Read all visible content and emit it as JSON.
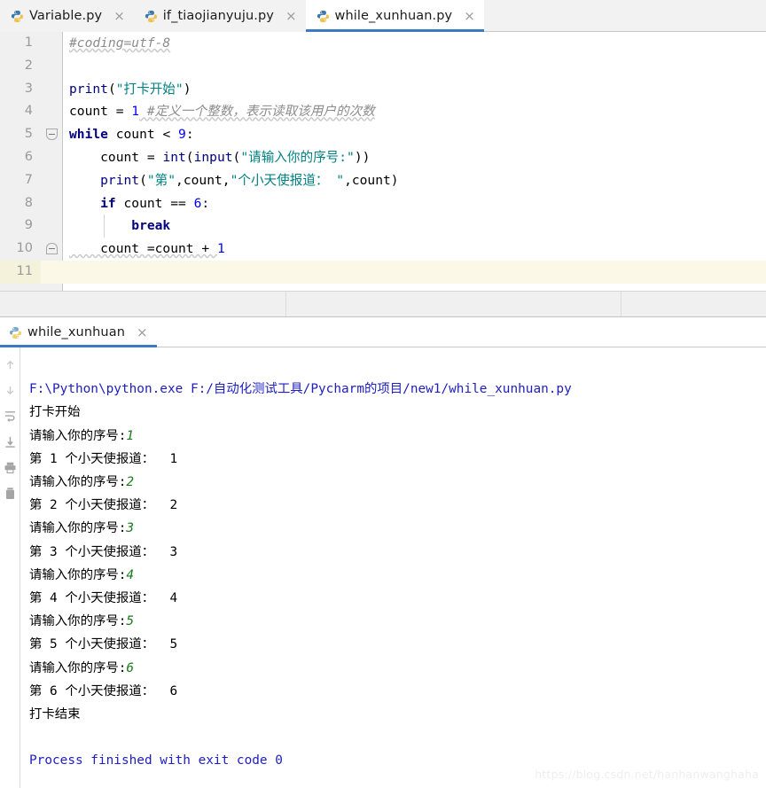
{
  "colors": {
    "accent": "#3a7cc4",
    "tab_inactive_bg": "#f2f2f2",
    "tab_active_bg": "#ffffff",
    "gutter_bg": "#f0f0f0",
    "current_line_bg": "#fbf8e8",
    "keyword": "#000080",
    "string": "#008080",
    "number": "#0000ff",
    "comment": "#8c8c8c",
    "console_command": "#2020c0",
    "console_input": "#1a7a1a",
    "watermark": "#eeeeee"
  },
  "editor_tabs": [
    {
      "label": "Variable.py",
      "icon": "python-file-icon",
      "close": "×",
      "active": false
    },
    {
      "label": "if_tiaojianyuju.py",
      "icon": "python-file-icon",
      "close": "×",
      "active": false
    },
    {
      "label": "while_xunhuan.py",
      "icon": "python-file-icon",
      "close": "×",
      "active": true
    }
  ],
  "editor": {
    "lines": [
      {
        "n": "1",
        "current": false
      },
      {
        "n": "2",
        "current": false
      },
      {
        "n": "3",
        "current": false
      },
      {
        "n": "4",
        "current": false
      },
      {
        "n": "5",
        "current": false
      },
      {
        "n": "6",
        "current": false
      },
      {
        "n": "7",
        "current": false
      },
      {
        "n": "8",
        "current": false
      },
      {
        "n": "9",
        "current": false
      },
      {
        "n": "10",
        "current": false
      },
      {
        "n": "11",
        "current": true
      }
    ],
    "code": {
      "l1_comment": "#coding=utf-8",
      "l3_fn": "print",
      "l3_open": "(",
      "l3_str": "\"打卡开始\"",
      "l3_close": ")",
      "l4_name": "count = ",
      "l4_num": "1",
      "l4_comment": " #定义一个整数，表示读取该用户的次数",
      "l5_kw": "while",
      "l5_rest": " count < ",
      "l5_num": "9",
      "l5_colon": ":",
      "l6_a": "    count = ",
      "l6_fn1": "int",
      "l6_p1": "(",
      "l6_fn2": "input",
      "l6_p2": "(",
      "l6_str": "\"请输入你的序号:\"",
      "l6_p3": "))",
      "l7_fn": "    print",
      "l7_p1": "(",
      "l7_s1": "\"第\"",
      "l7_c1": ",count,",
      "l7_s2": "\"个小天使报道： \"",
      "l7_c2": ",count)",
      "l8_kw": "    if",
      "l8_rest": " count == ",
      "l8_num": "6",
      "l8_colon": ":",
      "l9_kw": "        break",
      "l10_a": "    count =count + ",
      "l10_num": "1"
    },
    "fold_markers": [
      {
        "line": 5,
        "name": "fold-region-open",
        "glyph": "−"
      },
      {
        "line": 10,
        "name": "fold-region-close",
        "glyph": "−"
      }
    ]
  },
  "console_tabs": [
    {
      "label": "while_xunhuan",
      "icon": "python-run-icon",
      "close": "×",
      "active": true
    }
  ],
  "console_toolbar": [
    {
      "name": "rerun-up-icon"
    },
    {
      "name": "scroll-down-icon"
    },
    {
      "name": "soft-wrap-icon"
    },
    {
      "name": "scroll-to-end-icon"
    },
    {
      "name": "print-icon"
    },
    {
      "name": "clear-all-icon"
    }
  ],
  "console": {
    "command": "F:\\Python\\python.exe F:/自动化测试工具/Pycharm的项目/new1/while_xunhuan.py",
    "lines": [
      {
        "kind": "out",
        "text": "打卡开始"
      },
      {
        "kind": "prompt",
        "text": "请输入你的序号:",
        "input": "1"
      },
      {
        "kind": "out",
        "text": "第 1 个小天使报道：  1"
      },
      {
        "kind": "prompt",
        "text": "请输入你的序号:",
        "input": "2"
      },
      {
        "kind": "out",
        "text": "第 2 个小天使报道：  2"
      },
      {
        "kind": "prompt",
        "text": "请输入你的序号:",
        "input": "3"
      },
      {
        "kind": "out",
        "text": "第 3 个小天使报道：  3"
      },
      {
        "kind": "prompt",
        "text": "请输入你的序号:",
        "input": "4"
      },
      {
        "kind": "out",
        "text": "第 4 个小天使报道：  4"
      },
      {
        "kind": "prompt",
        "text": "请输入你的序号:",
        "input": "5"
      },
      {
        "kind": "out",
        "text": "第 5 个小天使报道：  5"
      },
      {
        "kind": "prompt",
        "text": "请输入你的序号:",
        "input": "6"
      },
      {
        "kind": "out",
        "text": "第 6 个小天使报道：  6"
      },
      {
        "kind": "out",
        "text": "打卡结束"
      },
      {
        "kind": "blank",
        "text": ""
      },
      {
        "kind": "done",
        "text": "Process finished with exit code 0"
      }
    ]
  },
  "watermark": "https://blog.csdn.net/hanhanwanghaha"
}
